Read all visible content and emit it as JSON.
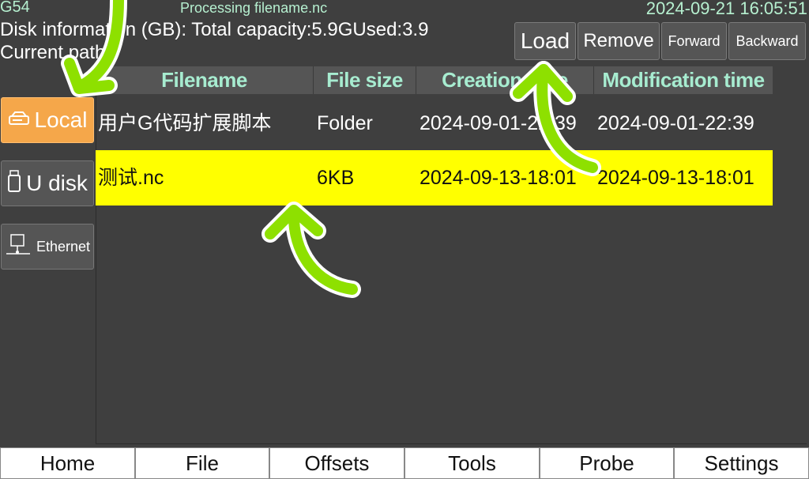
{
  "status": {
    "coord_system": "G54",
    "processing": "Processing filename.nc",
    "datetime": "2024-09-21 16:05:51"
  },
  "disk": {
    "info": "Disk information (GB): Total capacity:5.9GUsed:3.9",
    "current_path": "Current path: /"
  },
  "actions": {
    "load": "Load",
    "remove": "Remove",
    "forward": "Forward",
    "backward": "Backward"
  },
  "storage": {
    "local": "Local",
    "udisk": "U disk",
    "ethernet": "Ethernet"
  },
  "table": {
    "headers": {
      "filename": "Filename",
      "size": "File size",
      "ctime": "Creation time",
      "mtime": "Modification time"
    },
    "rows": [
      {
        "name": "用户G代码扩展脚本",
        "size": "Folder",
        "ctime": "2024-09-01-22:39",
        "mtime": "2024-09-01-22:39"
      },
      {
        "name": "测试.nc",
        "size": "6KB",
        "ctime": "2024-09-13-18:01",
        "mtime": "2024-09-13-18:01"
      }
    ]
  },
  "nav": {
    "home": "Home",
    "file": "File",
    "offsets": "Offsets",
    "tools": "Tools",
    "probe": "Probe",
    "settings": "Settings"
  },
  "colors": {
    "background": "#3f3f3f",
    "header_text": "#a7ecd0",
    "selected_row": "#ffff00",
    "active_storage": "#f5a74a",
    "annotation_arrow": "#8ee000"
  },
  "icons": {
    "local": "hard-drive-icon",
    "udisk": "usb-drive-icon",
    "ethernet": "network-icon"
  }
}
